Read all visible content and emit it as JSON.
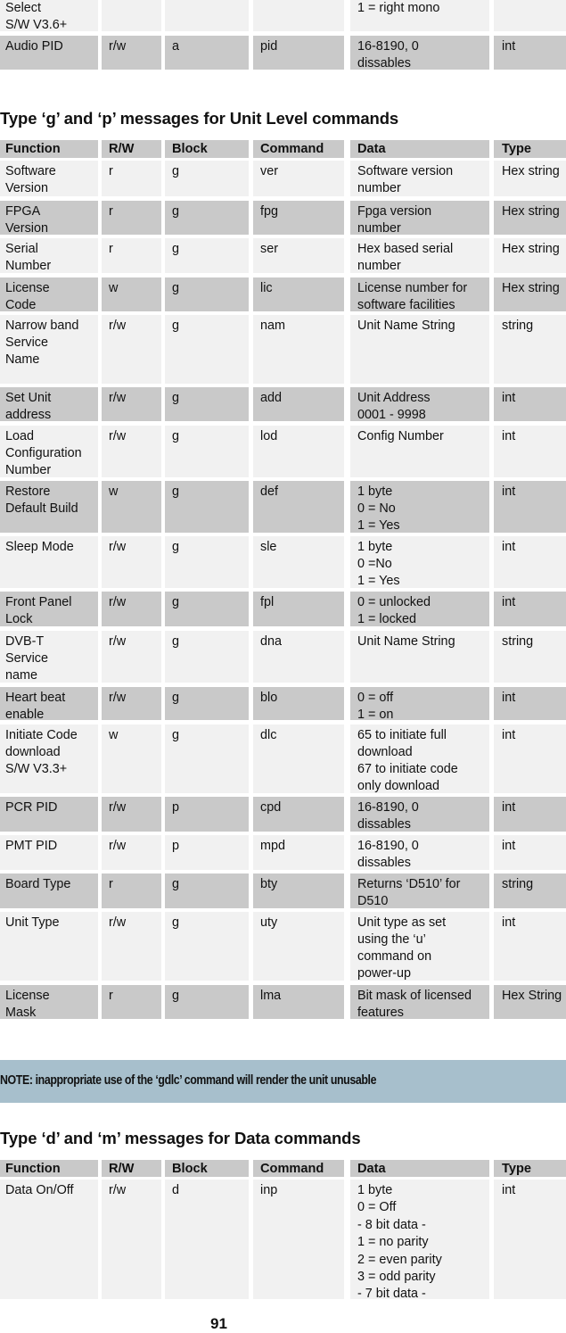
{
  "top_table": {
    "rows": [
      {
        "function": "Select\nS/W V3.6+",
        "rw": "",
        "block": "",
        "command": "",
        "data": "1 = right mono",
        "type": ""
      },
      {
        "function": "Audio PID",
        "rw": "r/w",
        "block": "a",
        "command": "pid",
        "data": "16-8190, 0\ndissables",
        "type": "int"
      }
    ]
  },
  "section_unit": {
    "heading": "Type ‘g’ and ‘p’ messages for Unit Level commands",
    "columns": [
      "Function",
      "R/W",
      "Block",
      "Command",
      "Data",
      "Type"
    ],
    "rows": [
      {
        "function": "Software\nVersion",
        "rw": "r",
        "block": "g",
        "command": "ver",
        "data": "Software version\nnumber",
        "type": "Hex string"
      },
      {
        "function": "FPGA\nVersion",
        "rw": "r",
        "block": "g",
        "command": "fpg",
        "data": "Fpga version\nnumber",
        "type": "Hex string"
      },
      {
        "function": "Serial\nNumber",
        "rw": "r",
        "block": "g",
        "command": "ser",
        "data": "Hex based serial\nnumber",
        "type": "Hex string"
      },
      {
        "function": "License\nCode",
        "rw": "w",
        "block": "g",
        "command": "lic",
        "data": "License number for\nsoftware facilities",
        "type": "Hex string"
      },
      {
        "function": "Narrow band\nService\nName",
        "rw": "r/w",
        "block": "g",
        "command": "nam",
        "data": "Unit Name String",
        "type": "string"
      },
      {
        "function": "Set Unit\naddress",
        "rw": "r/w",
        "block": "g",
        "command": "add",
        "data": "Unit Address\n0001 - 9998",
        "type": "int"
      },
      {
        "function": "Load\nConfiguration\nNumber",
        "rw": "r/w",
        "block": "g",
        "command": "lod",
        "data": "Config Number",
        "type": "int"
      },
      {
        "function": "Restore\nDefault Build",
        "rw": "w",
        "block": "g",
        "command": "def",
        "data": "1 byte\n0 = No\n1 = Yes",
        "type": "int"
      },
      {
        "function": "Sleep Mode",
        "rw": "r/w",
        "block": "g",
        "command": "sle",
        "data": "1 byte\n0 =No\n1 = Yes",
        "type": "int"
      },
      {
        "function": "Front Panel\nLock",
        "rw": "r/w",
        "block": "g",
        "command": "fpl",
        "data": "0 = unlocked\n1 = locked",
        "type": "int"
      },
      {
        "function": "DVB-T\nService\nname",
        "rw": "r/w",
        "block": "g",
        "command": "dna",
        "data": "Unit Name String",
        "type": "string"
      },
      {
        "function": "Heart beat\nenable",
        "rw": "r/w",
        "block": "g",
        "command": "blo",
        "data": "0 = off\n1 = on",
        "type": "int"
      },
      {
        "function": "Initiate Code\ndownload\nS/W V3.3+",
        "rw": "w",
        "block": "g",
        "command": "dlc",
        "data": "65 to initiate full\ndownload\n67 to initiate code\nonly download",
        "type": "int"
      },
      {
        "function": "PCR PID",
        "rw": "r/w",
        "block": "p",
        "command": "cpd",
        "data": "16-8190, 0\ndissables",
        "type": "int"
      },
      {
        "function": "PMT PID",
        "rw": "r/w",
        "block": "p",
        "command": "mpd",
        "data": "16-8190, 0\ndissables",
        "type": "int"
      },
      {
        "function": "Board Type",
        "rw": "r",
        "block": "g",
        "command": "bty",
        "data": "Returns ‘D510’ for\nD510",
        "type": "string"
      },
      {
        "function": "Unit Type",
        "rw": "r/w",
        "block": "g",
        "command": "uty",
        "data": "Unit type as set\nusing the ‘u’\ncommand on\npower-up",
        "type": "int"
      },
      {
        "function": "License\nMask",
        "rw": "r",
        "block": "g",
        "command": "lma",
        "data": "Bit mask of licensed\nfeatures",
        "type": "Hex String"
      }
    ]
  },
  "note": "NOTE: inappropriate use of the ‘gdlc’ command will render the unit unusable",
  "section_data": {
    "heading": "Type ‘d’ and ‘m’ messages for Data commands",
    "columns": [
      "Function",
      "R/W",
      "Block",
      "Command",
      "Data",
      "Type"
    ],
    "rows": [
      {
        "function": "Data On/Off",
        "rw": "r/w",
        "block": "d",
        "command": "inp",
        "data": "1 byte\n0 = Off\n - 8 bit data -\n1 = no parity\n2 = even parity\n3 = odd parity\n - 7 bit data -",
        "type": "int"
      }
    ]
  },
  "page_number": "91"
}
